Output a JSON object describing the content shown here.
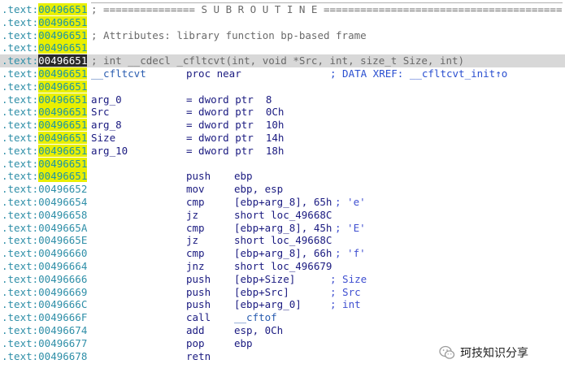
{
  "segment": ".text:",
  "top_partial": "; [",
  "lines": [
    {
      "offset": "00496651",
      "hl": "y",
      "kind": "comment",
      "text": "; =============== S U B R O U T I N E ======================================="
    },
    {
      "offset": "00496651",
      "hl": "y",
      "kind": "blank"
    },
    {
      "offset": "00496651",
      "hl": "y",
      "kind": "comment",
      "text": "; Attributes: library function bp-based frame"
    },
    {
      "offset": "00496651",
      "hl": "y",
      "kind": "blank"
    },
    {
      "offset": "00496651",
      "hl": "cur",
      "kind": "comment",
      "sel": true,
      "text": "; int __cdecl _cfltcvt(int, void *Src, int, size_t Size, int)"
    },
    {
      "offset": "00496651",
      "hl": "y",
      "kind": "proc",
      "name": "__cfltcvt",
      "mn": "proc near",
      "xref": "; DATA XREF: __cfltcvt_init↑o"
    },
    {
      "offset": "00496651",
      "hl": "y",
      "kind": "blank"
    },
    {
      "offset": "00496651",
      "hl": "y",
      "kind": "var",
      "name": "arg_0",
      "def": "= dword ptr  8"
    },
    {
      "offset": "00496651",
      "hl": "y",
      "kind": "var",
      "name": "Src",
      "def": "= dword ptr  0Ch"
    },
    {
      "offset": "00496651",
      "hl": "y",
      "kind": "var",
      "name": "arg_8",
      "def": "= dword ptr  10h"
    },
    {
      "offset": "00496651",
      "hl": "y",
      "kind": "var",
      "name": "Size",
      "def": "= dword ptr  14h"
    },
    {
      "offset": "00496651",
      "hl": "y",
      "kind": "var",
      "name": "arg_10",
      "def": "= dword ptr  18h"
    },
    {
      "offset": "00496651",
      "hl": "y",
      "kind": "blank"
    },
    {
      "offset": "00496651",
      "hl": "y",
      "kind": "ins",
      "mn": "push",
      "op": "ebp"
    },
    {
      "offset": "00496652",
      "hl": "n",
      "kind": "ins",
      "mn": "mov",
      "op": "ebp, esp"
    },
    {
      "offset": "00496654",
      "hl": "n",
      "kind": "ins",
      "mn": "cmp",
      "op": "[ebp+arg_8], 65h",
      "cm": "; 'e'"
    },
    {
      "offset": "00496658",
      "hl": "n",
      "kind": "ins",
      "mn": "jz",
      "op": "short loc_49668C"
    },
    {
      "offset": "0049665A",
      "hl": "n",
      "kind": "ins",
      "mn": "cmp",
      "op": "[ebp+arg_8], 45h",
      "cm": "; 'E'"
    },
    {
      "offset": "0049665E",
      "hl": "n",
      "kind": "ins",
      "mn": "jz",
      "op": "short loc_49668C"
    },
    {
      "offset": "00496660",
      "hl": "n",
      "kind": "ins",
      "mn": "cmp",
      "op": "[ebp+arg_8], 66h",
      "cm": "; 'f'"
    },
    {
      "offset": "00496664",
      "hl": "n",
      "kind": "ins",
      "mn": "jnz",
      "op": "short loc_496679"
    },
    {
      "offset": "00496666",
      "hl": "n",
      "kind": "ins",
      "mn": "push",
      "op": "[ebp+Size]",
      "cm": "; Size",
      "cmx": "far"
    },
    {
      "offset": "00496669",
      "hl": "n",
      "kind": "ins",
      "mn": "push",
      "op": "[ebp+Src]",
      "cm": "; Src",
      "cmx": "far"
    },
    {
      "offset": "0049666C",
      "hl": "n",
      "kind": "ins",
      "mn": "push",
      "op": "[ebp+arg_0]",
      "cm": "; int",
      "cmx": "far"
    },
    {
      "offset": "0049666F",
      "hl": "n",
      "kind": "ins",
      "mn": "call",
      "op": "__cftof",
      "call": true
    },
    {
      "offset": "00496674",
      "hl": "n",
      "kind": "ins",
      "mn": "add",
      "op": "esp, 0Ch"
    },
    {
      "offset": "00496677",
      "hl": "n",
      "kind": "ins",
      "mn": "pop",
      "op": "ebp"
    },
    {
      "offset": "00496678",
      "hl": "n",
      "kind": "ins",
      "mn": "retn",
      "op": ""
    }
  ],
  "watermark": {
    "text": "珂技知识分享",
    "icon": "wechat-icon"
  },
  "colors": {
    "highlight": "#e9ef00",
    "cursor": "#2a2a2a",
    "address": "#2f8fa8",
    "mnemonic": "#1a1a80",
    "comment": "#3f4fd0"
  }
}
